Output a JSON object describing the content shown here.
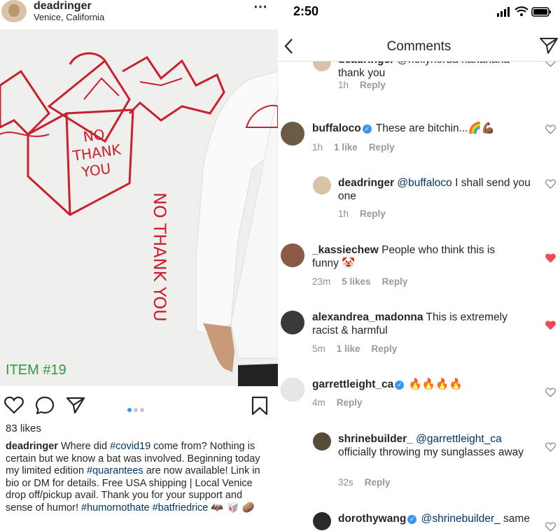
{
  "post": {
    "username": "deadringer",
    "location": "Venice, California",
    "more_icon": "⋯",
    "item_label": "ITEM #19",
    "image_text": "NO\nTHANK\nYOU",
    "likes": "83 likes",
    "caption": {
      "username": "deadringer",
      "part1": " Where did ",
      "tag1": "#covid19",
      "part2": " come from? Nothing is certain but we know a bat was involved. Beginning today my limited edition ",
      "tag2": "#quarantees",
      "part3": " are now available! Link in bio or DM for details. Free USA shipping | Local Venice drop off/pickup avail. Thank you for your support and sense of humor! ",
      "tag3": "#humornothate",
      "tag4": "#batfriedrice",
      "emojis": " 🦇 🥡 🥔"
    },
    "carousel": {
      "count": 3,
      "active_index": 0
    }
  },
  "status_bar": {
    "time": "2:50"
  },
  "nav": {
    "title": "Comments"
  },
  "comments": [
    {
      "user": "deadringer",
      "text": "@hollyhorua hahahaha thank you",
      "time": "1h",
      "likes": "",
      "reply": "Reply",
      "liked": false,
      "verified": false
    },
    {
      "user": "buffaloco",
      "text": "These are bitchin...🌈💪🏾",
      "time": "1h",
      "likes": "1 like",
      "reply": "Reply",
      "liked": false,
      "verified": true
    },
    {
      "user": "deadringer",
      "mention": "@buffaloco",
      "text": " I shall send you one",
      "time": "1h",
      "likes": "",
      "reply": "Reply",
      "liked": false,
      "verified": false
    },
    {
      "user": "_kassiechew",
      "text": " People who think this is funny 🤡",
      "time": "23m",
      "likes": "5 likes",
      "reply": "Reply",
      "liked": true,
      "verified": false
    },
    {
      "user": "alexandrea_madonna",
      "text": " This is extremely racist & harmful",
      "time": "5m",
      "likes": "1 like",
      "reply": "Reply",
      "liked": true,
      "verified": false
    },
    {
      "user": "garrettleight_ca",
      "text": "🔥🔥🔥🔥",
      "time": "4m",
      "likes": "",
      "reply": "Reply",
      "liked": false,
      "verified": true
    },
    {
      "user": "shrinebuilder_",
      "mention": "@garrettleight_ca",
      "text": " officially throwing my sunglasses away",
      "time": "32s",
      "likes": "",
      "reply": "Reply",
      "liked": false,
      "verified": false
    },
    {
      "user": "dorothywang",
      "mention": "@shrinebuilder_",
      "text": " same",
      "time": "",
      "likes": "",
      "reply": "",
      "liked": false,
      "verified": true
    }
  ],
  "colors": {
    "liked_heart": "#ed4956",
    "link": "#003569",
    "item_label": "#2e9b3f",
    "sketch_red": "#c8202e",
    "verified": "#3897f0"
  }
}
